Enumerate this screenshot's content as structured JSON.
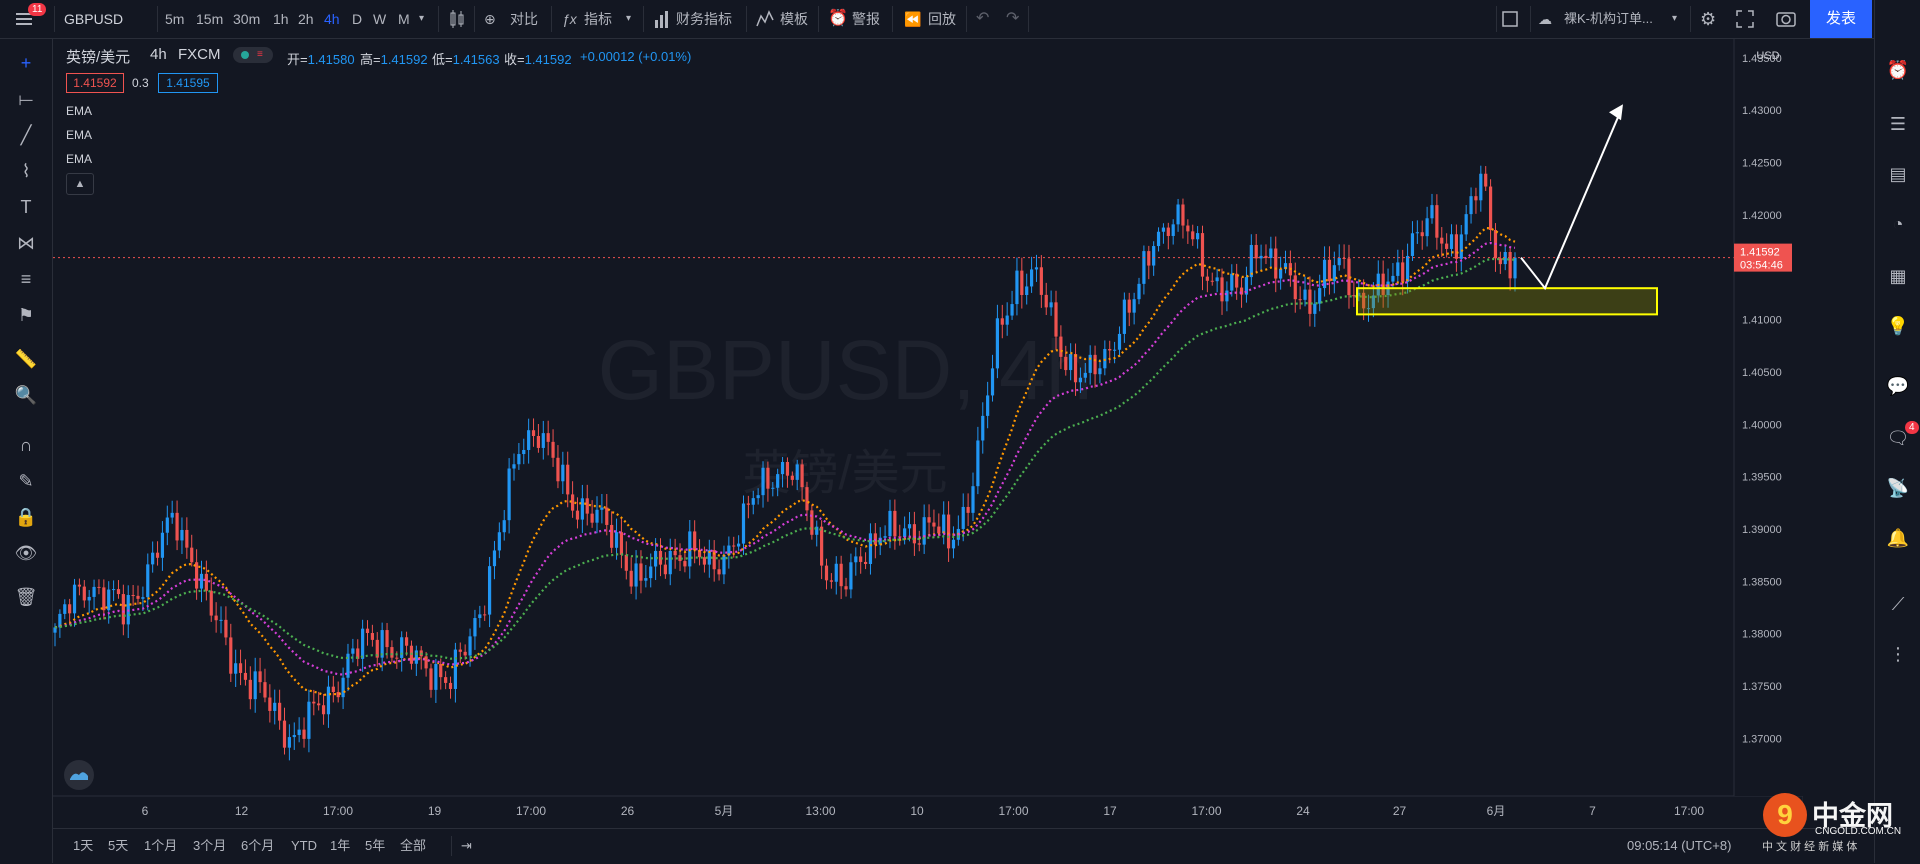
{
  "topbar": {
    "menu_badge": "11",
    "symbol": "GBPUSD",
    "intervals": [
      "5m",
      "15m",
      "30m",
      "1h",
      "2h",
      "4h",
      "D",
      "W",
      "M"
    ],
    "active_interval": "4h",
    "compare": "对比",
    "indicators": "指标",
    "financials": "财务指标",
    "templates": "模板",
    "alerts": "警报",
    "replay": "回放",
    "layout_name": "裸K-机构订单...",
    "publish": "发表"
  },
  "legend": {
    "pair": "英镑/美元",
    "interval": "4h",
    "source": "FXCM",
    "open_label": "开=",
    "open": "1.41580",
    "high_label": "高=",
    "high": "1.41592",
    "low_label": "低=",
    "low": "1.41563",
    "close_label": "收=",
    "close": "1.41592",
    "change": "+0.00012 (+0.01%)",
    "bid": "1.41592",
    "spread": "0.3",
    "ask": "1.41595",
    "indicators": [
      "EMA",
      "EMA",
      "EMA"
    ]
  },
  "watermark": {
    "line1": "GBPUSD, 4h",
    "line2": "英镑/美元"
  },
  "price_axis": {
    "currency": "USD",
    "ticks": [
      "1.43500",
      "1.43000",
      "1.42500",
      "1.42000",
      "1.41000",
      "1.40500",
      "1.40000",
      "1.39500",
      "1.39000",
      "1.38500",
      "1.38000",
      "1.37500",
      "1.37000"
    ],
    "last_price": "1.41592",
    "countdown": "03:54:46"
  },
  "time_axis": {
    "ticks": [
      "6",
      "12",
      "17:00",
      "19",
      "17:00",
      "26",
      "5月",
      "13:00",
      "10",
      "17:00",
      "17",
      "17:00",
      "24",
      "27",
      "6月",
      "7",
      "17:00"
    ]
  },
  "bottombar": {
    "ranges": [
      "1天",
      "5天",
      "1个月",
      "3个月",
      "6个月",
      "YTD",
      "1年",
      "5年",
      "全部"
    ],
    "clock": "09:05:14 (UTC+8)",
    "watermark_cn": "中金网",
    "watermark_url": "CNGOLD.COM.CN",
    "watermark_sub": "中 文 财 经 新 媒 体"
  },
  "rightbar": {
    "notif_badge": "4"
  },
  "colors": {
    "up": "#2196f3",
    "down": "#ef5350",
    "ema_fast": "#ff9800",
    "ema_mid": "#d53fd8",
    "ema_slow": "#4caf50",
    "zone": "#ffff00",
    "accent": "#2962ff",
    "last_price": "#ef5350"
  },
  "chart_data": {
    "type": "candlestick",
    "symbol": "GBPUSD",
    "interval": "4h",
    "ylim": [
      1.3645,
      1.4368
    ],
    "x_ticks": [
      "6",
      "12",
      "17:00",
      "19",
      "17:00",
      "26",
      "5月",
      "13:00",
      "10",
      "17:00",
      "17",
      "17:00",
      "24",
      "27",
      "6月",
      "7",
      "17:00"
    ],
    "close_path": [
      1.38,
      1.383,
      1.385,
      1.3835,
      1.382,
      1.385,
      1.388,
      1.391,
      1.3875,
      1.382,
      1.379,
      1.376,
      1.374,
      1.372,
      1.37,
      1.372,
      1.3745,
      1.377,
      1.379,
      1.38,
      1.378,
      1.3775,
      1.377,
      1.375,
      1.379,
      1.384,
      1.39,
      1.398,
      1.4,
      1.396,
      1.393,
      1.392,
      1.39,
      1.388,
      1.385,
      1.386,
      1.388,
      1.388,
      1.386,
      1.388,
      1.39,
      1.394,
      1.396,
      1.395,
      1.391,
      1.386,
      1.384,
      1.388,
      1.39,
      1.389,
      1.39,
      1.391,
      1.388,
      1.392,
      1.4,
      1.409,
      1.414,
      1.414,
      1.41,
      1.406,
      1.404,
      1.406,
      1.41,
      1.412,
      1.418,
      1.42,
      1.418,
      1.415,
      1.413,
      1.412,
      1.418,
      1.415,
      1.413,
      1.412,
      1.414,
      1.415,
      1.412,
      1.412,
      1.414,
      1.418,
      1.419,
      1.417,
      1.419,
      1.423,
      1.416,
      1.4159
    ],
    "ema_fast_end": 1.415,
    "ema_mid_end": 1.413,
    "ema_slow_end": 1.4105,
    "zone": {
      "from": 1.4105,
      "to": 1.413
    },
    "projection": {
      "from": 1.413,
      "to": 1.43
    }
  }
}
